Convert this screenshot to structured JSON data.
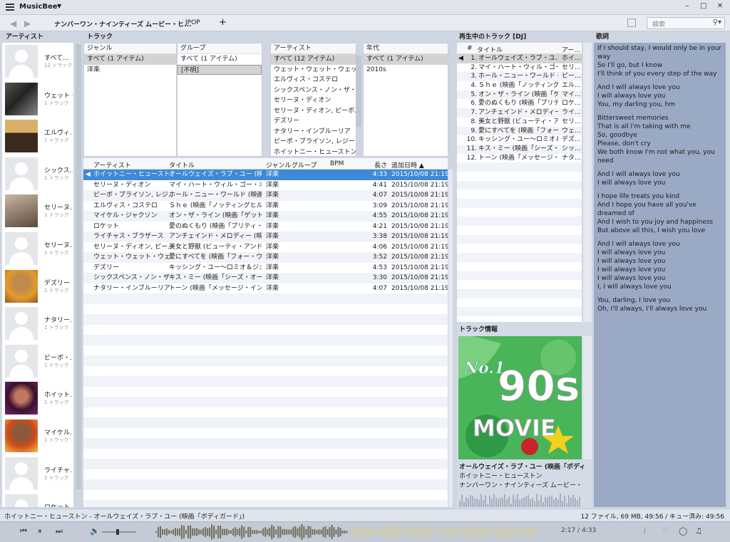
{
  "window": {
    "app_name": "MusicBee",
    "minimize": "–",
    "maximize": "□",
    "close": "✕"
  },
  "tabs": [
    {
      "label": "ナンバーワン・ナインティーズ ムービー・ヒ..."
    },
    {
      "label": "JPOP"
    },
    {
      "label": "+"
    }
  ],
  "search": {
    "placeholder": "検索"
  },
  "panels": {
    "artist": "アーティスト",
    "tracks": "トラック",
    "now_playing": "再生中のトラック [DJ]",
    "lyrics": "歌詞",
    "track_info": "トラック情報"
  },
  "artists": [
    {
      "name": "すべて...",
      "count": "12 トラック",
      "img": "ph"
    },
    {
      "name": "ウェット・...",
      "count": "1 トラック",
      "img": "bw"
    },
    {
      "name": "エルヴィ...",
      "count": "1 トラック",
      "img": "elvis"
    },
    {
      "name": "シックス...",
      "count": "1 トラック",
      "img": "ph"
    },
    {
      "name": "セリーヌ...",
      "count": "1 トラック",
      "img": "celine"
    },
    {
      "name": "セリーヌ...",
      "count": "1 トラック",
      "img": "ph"
    },
    {
      "name": "デズリー",
      "count": "1 トラック",
      "img": "des"
    },
    {
      "name": "ナタリー...",
      "count": "1 トラック",
      "img": "ph"
    },
    {
      "name": "ビーボ・...",
      "count": "1 トラック",
      "img": "ph"
    },
    {
      "name": "ホイット...",
      "count": "1 トラック",
      "img": "whit"
    },
    {
      "name": "マイケル...",
      "count": "1 トラック",
      "img": "mj"
    },
    {
      "name": "ライチャ...",
      "count": "1 トラック",
      "img": "ph"
    },
    {
      "name": "ロケット",
      "count": "",
      "img": "ph"
    }
  ],
  "filters": {
    "genre": {
      "header": "ジャンル",
      "items": [
        "すべて (1 アイテム)",
        "洋楽"
      ]
    },
    "group": {
      "header": "グループ",
      "items": [
        "すべて (1 アイテム)",
        "[不明]"
      ]
    },
    "artist": {
      "header": "アーティスト",
      "items": [
        "すべて (12 アイテム)",
        "ウェット・ウェット・ウェット",
        "エルヴィス・コステロ",
        "シックスペンス・ノン・ザ・リッチ...",
        "セリーヌ・ディオン",
        "セリーヌ・ディオン, ピーボ...",
        "デズリー",
        "ナタリー・インブルーリア",
        "ピーボ・ブライソン, レジーナ...",
        "ホイットニー・ヒューストン"
      ]
    },
    "year": {
      "header": "年代",
      "items": [
        "すべて (1 アイテム)",
        "2010s"
      ]
    }
  },
  "tracklist": {
    "headers": {
      "artist": "アーティスト",
      "title": "タイトル",
      "genre": "ジャンル",
      "group": "グループ",
      "bpm": "BPM",
      "length": "長さ",
      "added": "追加日時 ▲"
    },
    "rows": [
      {
        "artist": "ホイットニー・ヒューストン",
        "title": "オールウェイズ・ラブ・ユー (映画「...",
        "genre": "洋楽",
        "length": "4:33",
        "added": "2015/10/08 21:19"
      },
      {
        "artist": "セリーヌ・ディオン",
        "title": "マイ・ハート・ウィル・ゴー・オン (映...",
        "genre": "洋楽",
        "length": "4:41",
        "added": "2015/10/08 21:19"
      },
      {
        "artist": "ピーボ・ブライソン, レジ...",
        "title": "ホール・ニュー・ワールド (映画「ア...",
        "genre": "洋楽",
        "length": "4:07",
        "added": "2015/10/08 21:19"
      },
      {
        "artist": "エルヴィス・コステロ",
        "title": "Ｓｈｅ (映画「ノッティングヒルの...",
        "genre": "洋楽",
        "length": "3:09",
        "added": "2015/10/08 21:19"
      },
      {
        "artist": "マイケル・ジャクソン",
        "title": "オン・ザ・ライン (映画「ゲット・オン...",
        "genre": "洋楽",
        "length": "4:55",
        "added": "2015/10/08 21:19"
      },
      {
        "artist": "ロケット",
        "title": "愛のぬくもり (映画「プリティ・ウー...",
        "genre": "洋楽",
        "length": "4:21",
        "added": "2015/10/08 21:19"
      },
      {
        "artist": "ライチャス・ブラザース",
        "title": "アンチェインド・メロディー (映画「...",
        "genre": "洋楽",
        "length": "3:38",
        "added": "2015/10/08 21:19"
      },
      {
        "artist": "セリーヌ・ディオン, ピー...",
        "title": "美女と野獣 (ビューティ・アンド・...",
        "genre": "洋楽",
        "length": "4:06",
        "added": "2015/10/08 21:19"
      },
      {
        "artist": "ウェット・ウェット・ウェット",
        "title": "愛にすべてを (映画「フォー・ウェ...",
        "genre": "洋楽",
        "length": "3:52",
        "added": "2015/10/08 21:19"
      },
      {
        "artist": "デズリー",
        "title": "キッシング・ユー～ロミオ＆ジュリエ...",
        "genre": "洋楽",
        "length": "4:53",
        "added": "2015/10/08 21:19"
      },
      {
        "artist": "シックスペンス・ノン・ザ・リ...",
        "title": "キス・ミー (映画「シーズ・オール・...",
        "genre": "洋楽",
        "length": "3:30",
        "added": "2015/10/08 21:19"
      },
      {
        "artist": "ナタリー・インブルーリア",
        "title": "トーン (映画「メッセージ・イン・ア...",
        "genre": "洋楽",
        "length": "4:07",
        "added": "2015/10/08 21:19"
      }
    ]
  },
  "now_playing": {
    "headers": {
      "num": "#",
      "title": "タイトル",
      "artist": "アー..."
    },
    "rows": [
      {
        "num": "1.",
        "title": "オールウェイズ・ラブ・ユ...",
        "artist": "ホイ..."
      },
      {
        "num": "2.",
        "title": "マイ・ハート・ウィル・ゴー・オン...",
        "artist": "セリ..."
      },
      {
        "num": "3.",
        "title": "ホール・ニュー・ワールド (...",
        "artist": "ピー..."
      },
      {
        "num": "4.",
        "title": "Ｓｈｅ (映画「ノッティング...",
        "artist": "エル..."
      },
      {
        "num": "5.",
        "title": "オン・ザ・ライン (映画「ゲット...",
        "artist": "マイ..."
      },
      {
        "num": "6.",
        "title": "愛のぬくもり (映画「プリティ...",
        "artist": "ロケ..."
      },
      {
        "num": "7.",
        "title": "アンチェインド・メロディー (...",
        "artist": "ライ..."
      },
      {
        "num": "8.",
        "title": "美女と野獣 (ビューティ・ア...",
        "artist": "セリ..."
      },
      {
        "num": "9.",
        "title": "愛にすべてを (映画「フォー・...",
        "artist": "ウェ..."
      },
      {
        "num": "10.",
        "title": "キッシング・ユー～ロミオ＆ジ...",
        "artist": "デズ..."
      },
      {
        "num": "11.",
        "title": "キス・ミー (映画「シーズ・オ...",
        "artist": "シッ..."
      },
      {
        "num": "12.",
        "title": "トーン (映画「メッセージ・イ...",
        "artist": "ナタ..."
      }
    ]
  },
  "lyrics": [
    [
      "If I should stay, I would only be in your way",
      "So I'll go, but I know",
      "I'll think of you every step of the way"
    ],
    [
      "And I will always love you",
      "I will always love you",
      "You, my darling you, hm"
    ],
    [
      "Bittersweet memories",
      "That is all I'm taking with me",
      "So, goodbye",
      "Please, don't cry",
      "We both know I'm not what you, you need"
    ],
    [
      "And I will always love you",
      "I will always love you"
    ],
    [
      "I hope life treats you kind",
      "And I hope you have all you've dreamed of",
      "And I wish to you joy and happiness",
      "But above all this, I wish you love"
    ],
    [
      "And I will always love you",
      "I will always love you",
      "I will always love you",
      "I will always love you",
      "I will always love you",
      "I, I will always love you"
    ],
    [
      "You, darling, I love you",
      "Oh, I'll always, I'll always love you"
    ]
  ],
  "track_info": {
    "title": "オールウェイズ・ラブ・ユー (映画「ボディガー...",
    "artist": "ホイットニー・ヒューストン",
    "album": "ナンバーワン・ナインティーズ ムービー・ヒッツ D...",
    "cover_text_a": "No.1",
    "cover_text_b": "90s",
    "cover_text_c": "MOVIE"
  },
  "status": {
    "left": "ホイットニー・ヒューストン - オールウェイズ・ラブ・ユー (映画「ボディガード」)",
    "right": "12 ファイル, 69 MB, 49:56 /  キュー済み: 49:56"
  },
  "player": {
    "position": "2:17",
    "duration": "4:33",
    "progress": 0.501,
    "volume": 0.45
  }
}
